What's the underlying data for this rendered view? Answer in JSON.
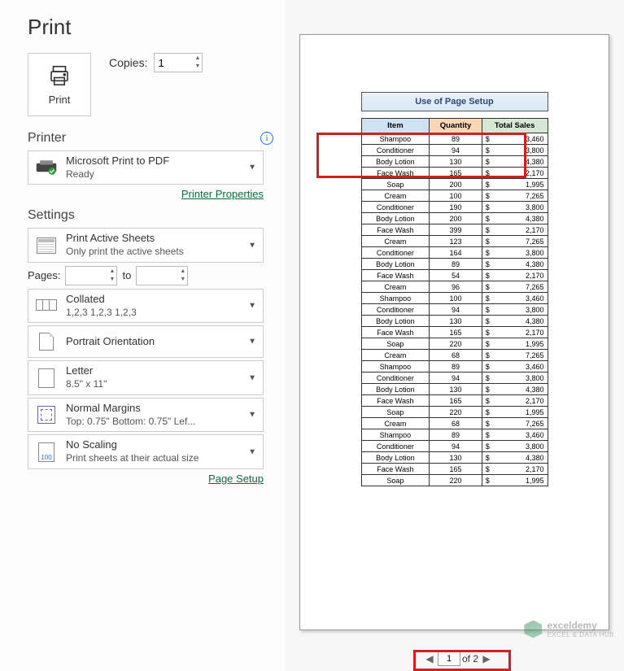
{
  "title": "Print",
  "print": {
    "button_label": "Print",
    "copies_label": "Copies:",
    "copies_value": "1"
  },
  "printer": {
    "section": "Printer",
    "name": "Microsoft Print to PDF",
    "status": "Ready",
    "properties_link": "Printer Properties"
  },
  "settings": {
    "section": "Settings",
    "active_sheets": {
      "title": "Print Active Sheets",
      "sub": "Only print the active sheets"
    },
    "pages": {
      "label": "Pages:",
      "to": "to",
      "from_value": "",
      "to_value": ""
    },
    "collated": {
      "title": "Collated",
      "sub": "1,2,3   1,2,3   1,2,3"
    },
    "orientation": {
      "title": "Portrait Orientation"
    },
    "paper": {
      "title": "Letter",
      "sub": "8.5\" x 11\""
    },
    "margins": {
      "title": "Normal Margins",
      "sub": "Top: 0.75\" Bottom: 0.75\" Lef..."
    },
    "scaling": {
      "title": "No Scaling",
      "sub": "Print sheets at their actual size",
      "badge": "100"
    },
    "page_setup_link": "Page Setup"
  },
  "preview": {
    "sheet_title": "Use of Page Setup",
    "headers": [
      "Item",
      "Quantity",
      "Total Sales"
    ],
    "rows": [
      [
        "Shampoo",
        "89",
        "3,460"
      ],
      [
        "Conditioner",
        "94",
        "3,800"
      ],
      [
        "Body Lotion",
        "130",
        "4,380"
      ],
      [
        "Face Wash",
        "165",
        "2,170"
      ],
      [
        "Soap",
        "200",
        "1,995"
      ],
      [
        "Cream",
        "100",
        "7,265"
      ],
      [
        "Conditioner",
        "190",
        "3,800"
      ],
      [
        "Body Lotion",
        "200",
        "4,380"
      ],
      [
        "Face Wash",
        "399",
        "2,170"
      ],
      [
        "Cream",
        "123",
        "7,265"
      ],
      [
        "Conditioner",
        "164",
        "3,800"
      ],
      [
        "Body Lotion",
        "89",
        "4,380"
      ],
      [
        "Face Wash",
        "54",
        "2,170"
      ],
      [
        "Cream",
        "96",
        "7,265"
      ],
      [
        "Shampoo",
        "100",
        "3,460"
      ],
      [
        "Conditioner",
        "94",
        "3,800"
      ],
      [
        "Body Lotion",
        "130",
        "4,380"
      ],
      [
        "Face Wash",
        "165",
        "2,170"
      ],
      [
        "Soap",
        "220",
        "1,995"
      ],
      [
        "Cream",
        "68",
        "7,265"
      ],
      [
        "Shampoo",
        "89",
        "3,460"
      ],
      [
        "Conditioner",
        "94",
        "3,800"
      ],
      [
        "Body Lotion",
        "130",
        "4,380"
      ],
      [
        "Face Wash",
        "165",
        "2,170"
      ],
      [
        "Soap",
        "220",
        "1,995"
      ],
      [
        "Cream",
        "68",
        "7,265"
      ],
      [
        "Shampoo",
        "89",
        "3,460"
      ],
      [
        "Conditioner",
        "94",
        "3,800"
      ],
      [
        "Body Lotion",
        "130",
        "4,380"
      ],
      [
        "Face Wash",
        "165",
        "2,170"
      ],
      [
        "Soap",
        "220",
        "1,995"
      ]
    ]
  },
  "pagenav": {
    "current": "1",
    "total_label": "of 2"
  },
  "watermark": {
    "brand": "exceldemy",
    "tagline": "EXCEL & DATA HUB"
  }
}
